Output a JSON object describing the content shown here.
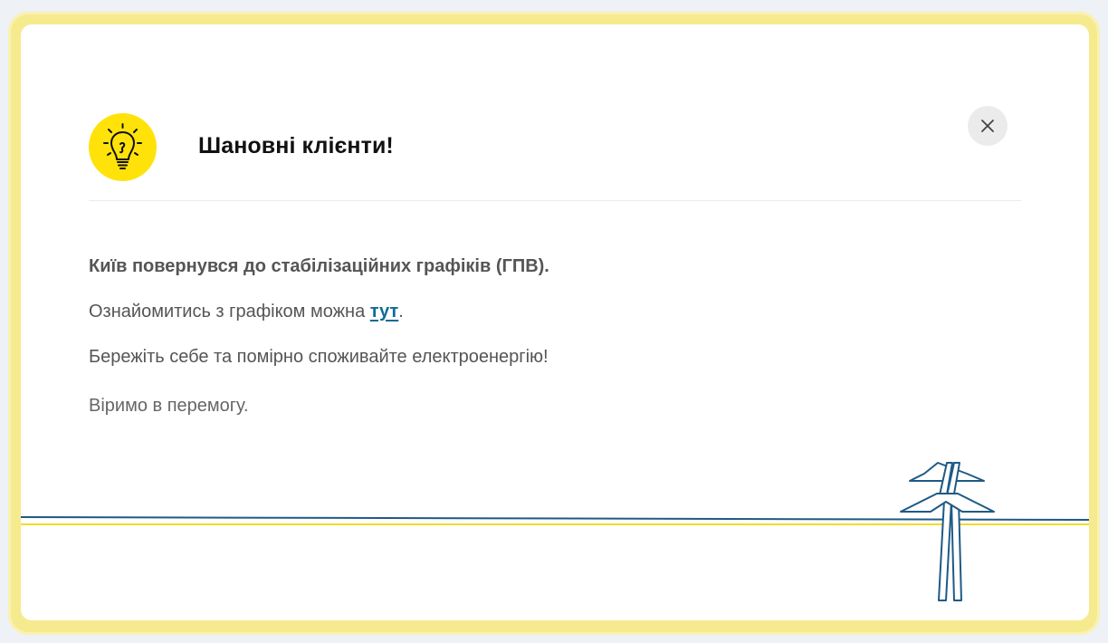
{
  "modal": {
    "title": "Шановні клієнти!",
    "bulb_icon": "lightbulb-icon",
    "close_icon": "close-icon",
    "bulb_color": "#ffe20a",
    "frame_color": "#f6ea8e",
    "line_blue": "#1f5a86",
    "line_yellow": "#f2dc2a"
  },
  "message": {
    "line1": "Київ повернувся до стабілізаційних графіків (ГПВ).",
    "line2_prefix": "Ознайомитись з графіком можна ",
    "line2_link": "тут",
    "line2_suffix": ".",
    "line3": "Бережіть себе та помірно споживайте електроенергію!",
    "line4": "Віримо в перемогу."
  },
  "decoration": {
    "pylon_icon": "power-pylon-icon"
  }
}
